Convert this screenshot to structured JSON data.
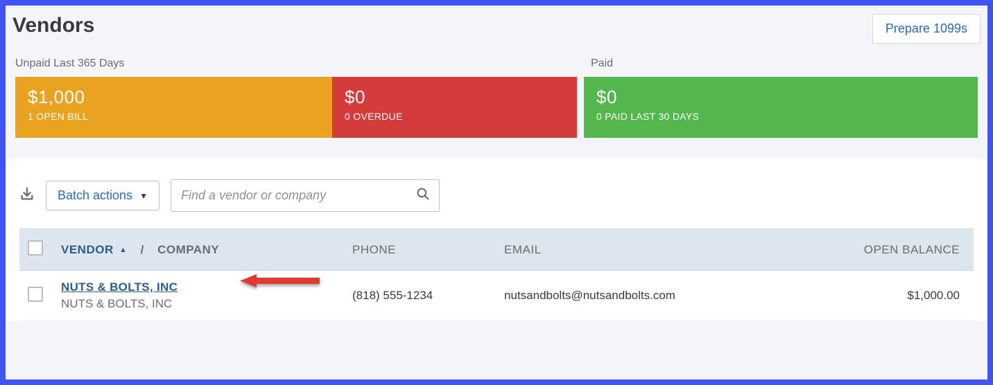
{
  "header": {
    "title": "Vendors",
    "prepare_label": "Prepare 1099s"
  },
  "summary": {
    "unpaid_label": "Unpaid Last 365 Days",
    "paid_label": "Paid",
    "open": {
      "amount": "$1,000",
      "sub": "1 OPEN BILL"
    },
    "overdue": {
      "amount": "$0",
      "sub": "0 OVERDUE"
    },
    "paid": {
      "amount": "$0",
      "sub": "0 PAID LAST 30 DAYS"
    }
  },
  "toolbar": {
    "batch_label": "Batch actions",
    "search_placeholder": "Find a vendor or company"
  },
  "columns": {
    "vendor": "VENDOR",
    "company": "COMPANY",
    "phone": "PHONE",
    "email": "EMAIL",
    "balance": "OPEN BALANCE"
  },
  "rows": [
    {
      "vendor": "NUTS & BOLTS, INC",
      "company": "NUTS & BOLTS, INC",
      "phone": "(818) 555-1234",
      "email": "nutsandbolts@nutsandbolts.com",
      "balance": "$1,000.00"
    }
  ]
}
